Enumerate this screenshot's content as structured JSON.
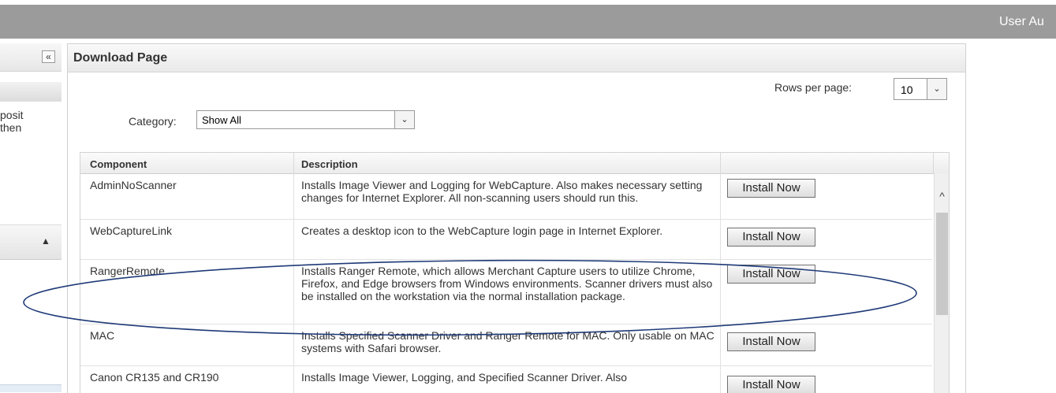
{
  "header": {
    "user_label": "User Au"
  },
  "sidebar": {
    "collapse_glyph": "«",
    "text_line1": "posit",
    "text_line2": "then",
    "expand_glyph": "▲"
  },
  "panel": {
    "title": "Download Page",
    "rows_per_page_label": "Rows per page:",
    "rows_per_page_value": "10",
    "category_label": "Category:",
    "category_value": "Show All",
    "dropdown_glyph": "⌄"
  },
  "table": {
    "columns": [
      "Component",
      "Description",
      ""
    ],
    "install_label": "Install Now",
    "rows": [
      {
        "component": "AdminNoScanner",
        "description": "Installs Image Viewer and Logging for WebCapture. Also makes necessary setting changes for Internet Explorer. All non-scanning users should run this."
      },
      {
        "component": "WebCaptureLink",
        "description": "Creates a desktop icon to the WebCapture login page in Internet Explorer."
      },
      {
        "component": "RangerRemote",
        "description": "Installs Ranger Remote, which allows Merchant Capture users to utilize Chrome, Firefox, and Edge browsers from Windows environments. Scanner drivers must also be installed on the workstation via the normal installation package."
      },
      {
        "component": "MAC",
        "description": "Installs Specified Scanner Driver and Ranger Remote for MAC. Only usable on MAC systems with Safari browser."
      },
      {
        "component": "Canon CR135 and CR190",
        "description": "Installs Image Viewer, Logging, and Specified Scanner Driver. Also"
      }
    ]
  },
  "annotation": {
    "color": "#1f3a78"
  },
  "scrollbar": {
    "up_glyph": "^"
  }
}
